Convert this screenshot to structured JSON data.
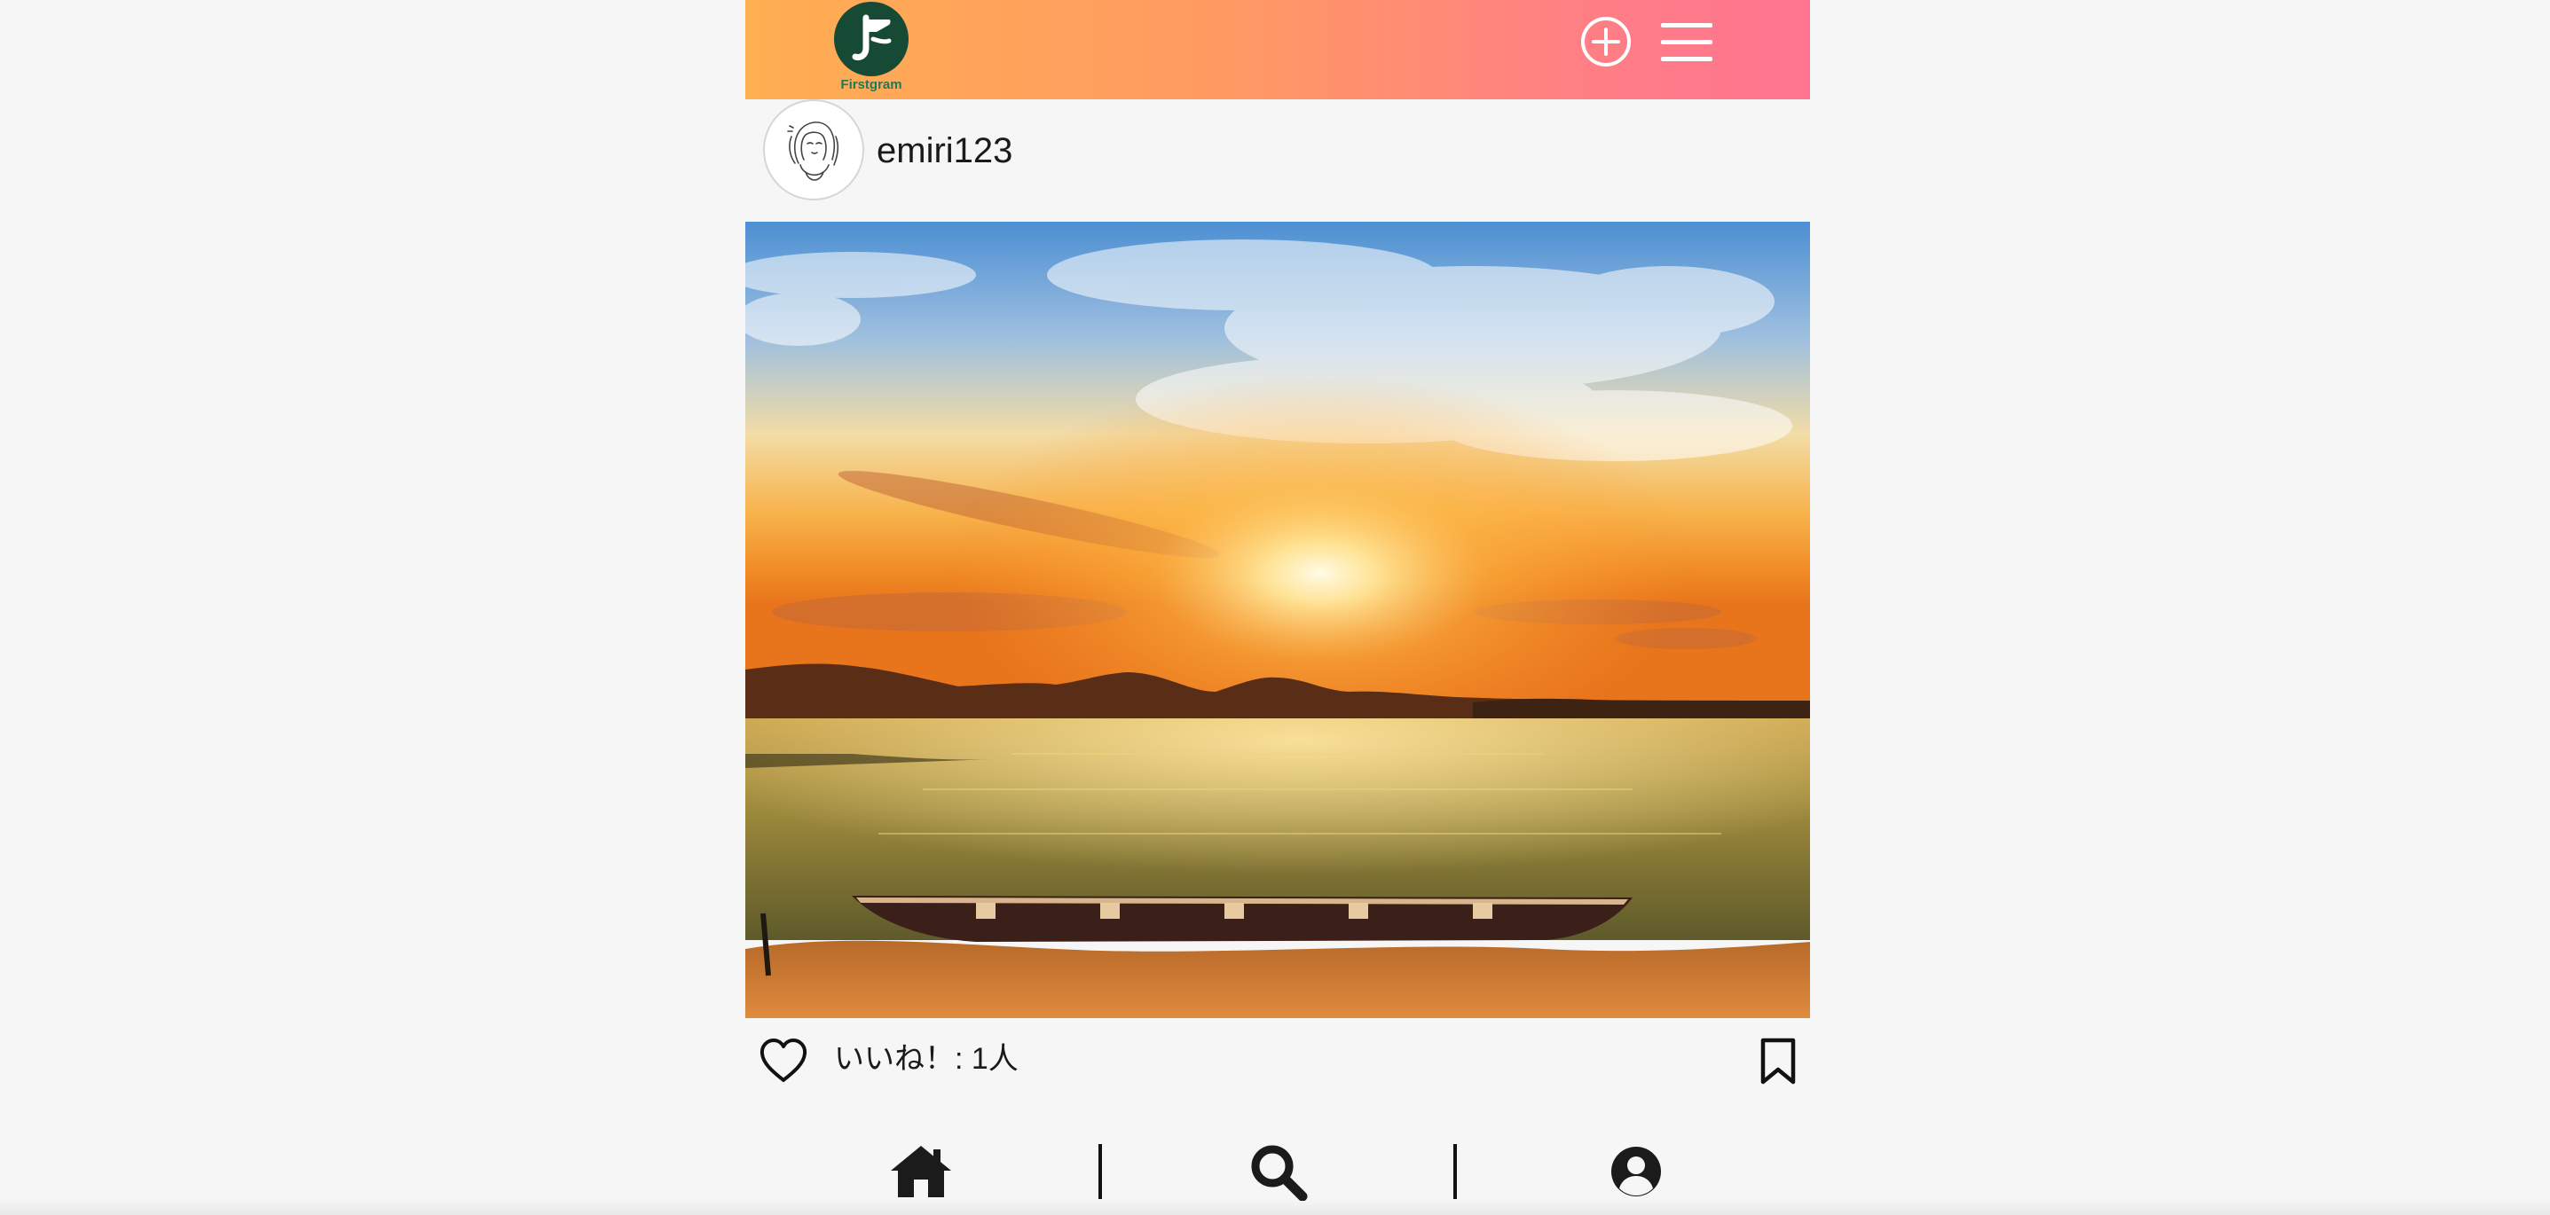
{
  "header": {
    "logo_text": "Firstgram",
    "gradient_colors": [
      "#ffae52",
      "#ff7590"
    ],
    "logo_color": "#164a35",
    "add_icon": "plus-circle-icon",
    "menu_icon": "hamburger-menu-icon"
  },
  "post": {
    "username": "emiri123",
    "avatar_icon": "user-sketch-avatar",
    "image_description_icon": "sunset-lake-boat-photo",
    "likes_text": "いいね！: 1人",
    "like_icon": "heart-outline-icon",
    "bookmark_icon": "bookmark-outline-icon"
  },
  "bottom_nav": {
    "items": [
      {
        "icon": "home-icon"
      },
      {
        "icon": "search-icon"
      },
      {
        "icon": "user-circle-icon"
      }
    ]
  }
}
